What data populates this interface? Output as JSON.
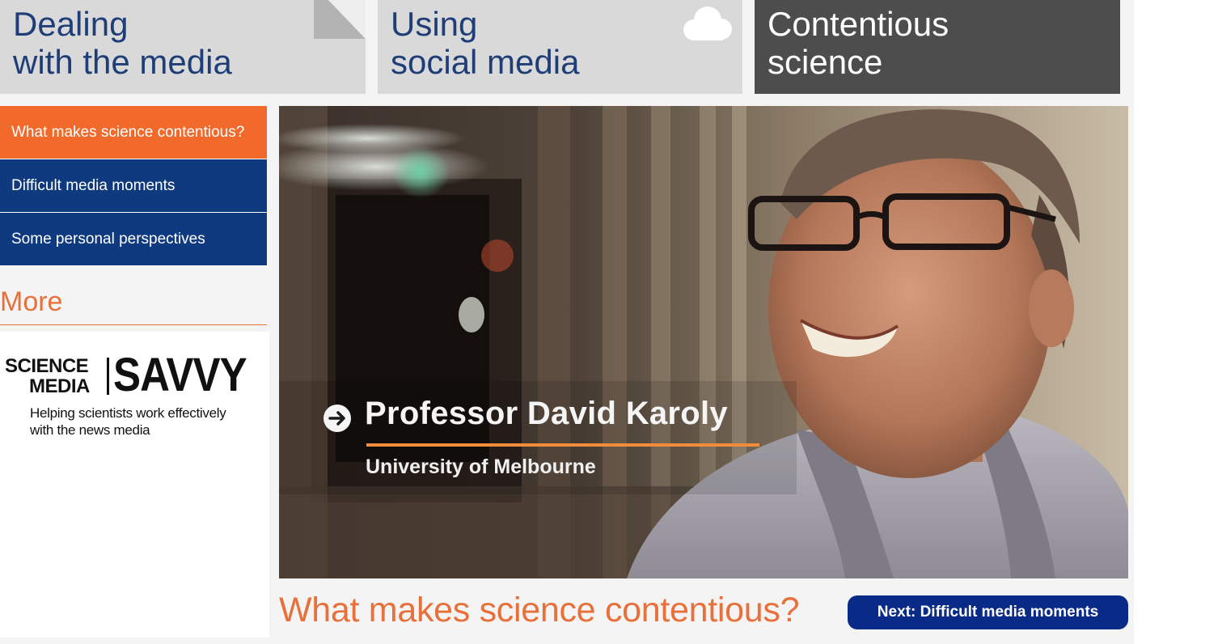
{
  "tiles": [
    {
      "line1": "Dealing",
      "line2": "with the media",
      "icon": "folded-corner-icon"
    },
    {
      "line1": "Using",
      "line2": "social media",
      "icon": "cloud-icon"
    },
    {
      "line1": "Contentious",
      "line2": "science",
      "active": true
    }
  ],
  "sidebar": {
    "items": [
      {
        "label": "What makes science contentious?",
        "active": true
      },
      {
        "label": "Difficult media moments"
      },
      {
        "label": "Some personal perspectives"
      }
    ],
    "more_heading": "More",
    "logo": {
      "science": "SCIENCE",
      "media": "MEDIA",
      "savvy": "SAVVY",
      "tagline_line1": "Helping scientists work effectively",
      "tagline_line2": "with the news media"
    }
  },
  "video": {
    "caption_name": "Professor David Karoly",
    "caption_affiliation": "University of Melbourne"
  },
  "main": {
    "heading": "What makes science contentious?",
    "next_button": "Next: Difficult media moments"
  },
  "colors": {
    "accent_orange": "#f26a2b",
    "nav_blue": "#0f3a80",
    "tile_grey": "#d9d9d9",
    "tile_dark": "#4d4d4d",
    "next_button_blue": "#0a2a88"
  }
}
